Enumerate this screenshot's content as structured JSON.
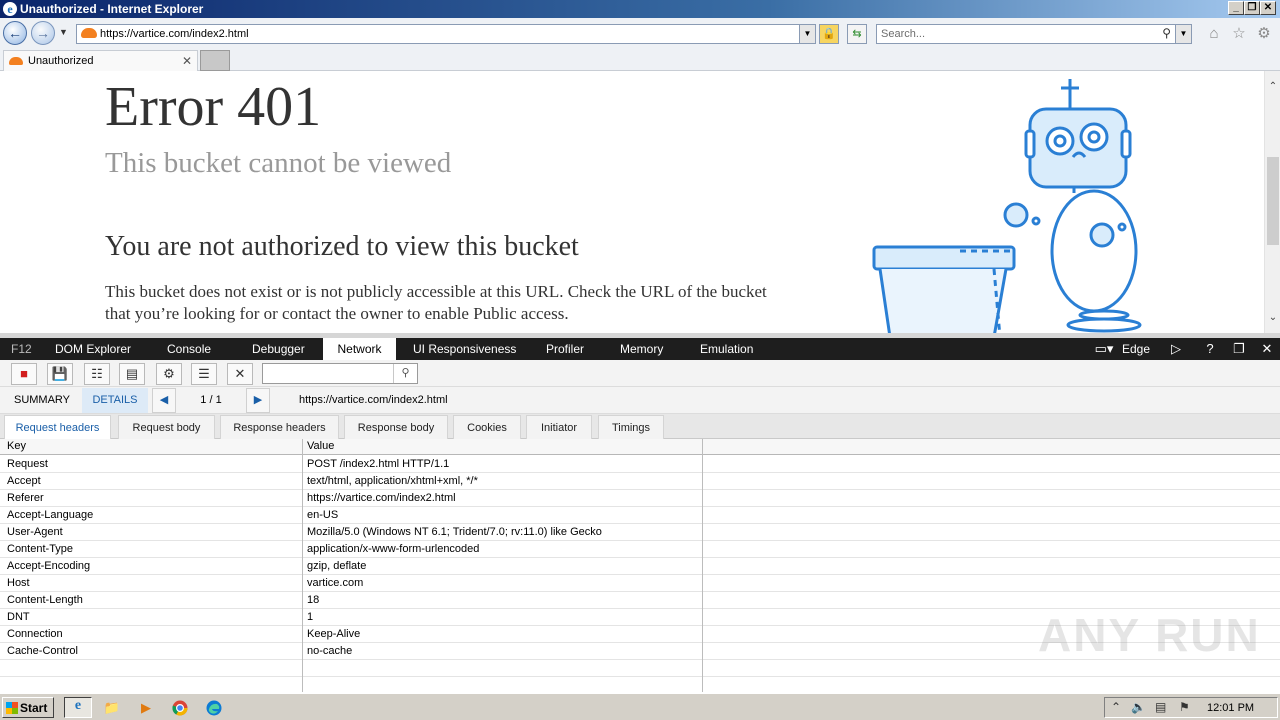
{
  "window": {
    "title": "Unauthorized - Internet Explorer",
    "minimize": "_",
    "restore": "❐",
    "close": "✕"
  },
  "navbar": {
    "back_icon": "back-arrow-icon",
    "forward_icon": "forward-arrow-icon",
    "url": "https://vartice.com/index2.html",
    "search_placeholder": "Search..."
  },
  "tabs": [
    {
      "label": "Unauthorized",
      "active": true
    }
  ],
  "page": {
    "heading": "Error 401",
    "subheading": "This bucket cannot be viewed",
    "title": "You are not authorized to view this bucket",
    "body": "This bucket does not exist or is not publicly accessible at this URL. Check the URL of the bucket that you’re looking for or contact the owner to enable Public access."
  },
  "devtools": {
    "tabs": [
      "F12",
      "DOM Explorer",
      "Console",
      "Debugger",
      "Network",
      "UI Responsiveness",
      "Profiler",
      "Memory",
      "Emulation"
    ],
    "active_tab": "Network",
    "browser_mode": "Edge",
    "help": "?",
    "nav": {
      "summary": "SUMMARY",
      "details": "DETAILS",
      "pager": "1 / 1",
      "url": "https://vartice.com/index2.html"
    },
    "subtabs": [
      "Request headers",
      "Request body",
      "Response headers",
      "Response body",
      "Cookies",
      "Initiator",
      "Timings"
    ],
    "active_subtab": "Request headers",
    "columns": [
      "Key",
      "Value"
    ],
    "headers": [
      {
        "key": "Request",
        "value": "POST /index2.html HTTP/1.1"
      },
      {
        "key": "Accept",
        "value": "text/html, application/xhtml+xml, */*"
      },
      {
        "key": "Referer",
        "value": "https://vartice.com/index2.html"
      },
      {
        "key": "Accept-Language",
        "value": "en-US"
      },
      {
        "key": "User-Agent",
        "value": "Mozilla/5.0 (Windows NT 6.1; Trident/7.0; rv:11.0) like Gecko"
      },
      {
        "key": "Content-Type",
        "value": "application/x-www-form-urlencoded"
      },
      {
        "key": "Accept-Encoding",
        "value": "gzip, deflate"
      },
      {
        "key": "Host",
        "value": "vartice.com"
      },
      {
        "key": "Content-Length",
        "value": "18"
      },
      {
        "key": "DNT",
        "value": "1"
      },
      {
        "key": "Connection",
        "value": "Keep-Alive"
      },
      {
        "key": "Cache-Control",
        "value": "no-cache"
      }
    ]
  },
  "watermark": "ANY RUN",
  "taskbar": {
    "start": "Start",
    "apps": [
      "internet-explorer-icon",
      "folder-icon",
      "media-player-icon",
      "chrome-icon",
      "edge-icon"
    ],
    "clock": "12:01 PM"
  },
  "colors": {
    "accent": "#1a5fa8",
    "title_gradient_start": "#0a246a",
    "record": "#d21d1d",
    "cloudflare": "#f38020"
  }
}
